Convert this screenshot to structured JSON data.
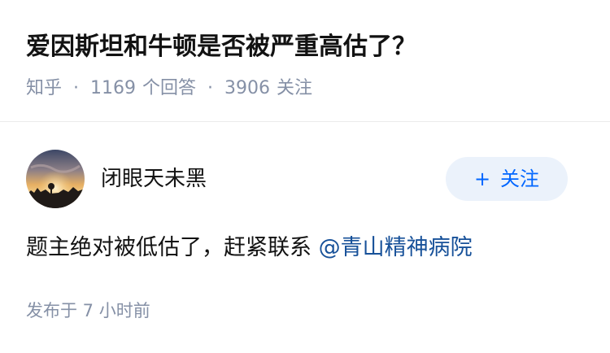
{
  "question": {
    "title": "爱因斯坦和牛顿是否被严重高估了？",
    "source": "知乎",
    "separator": "·",
    "answer_count": "1169",
    "answer_label": "个回答",
    "follower_count": "3906",
    "follower_label": "关注"
  },
  "author": {
    "name": "闭眼天未黑",
    "avatar_icon": "sunset-photo-avatar",
    "follow_icon": "plus-icon",
    "follow_plus": "+",
    "follow_label": "关注"
  },
  "answer": {
    "text": "题主绝对被低估了，赶紧联系 ",
    "mention": "@青山精神病院",
    "published": "发布于  7 小时前"
  },
  "colors": {
    "meta": "#8590a6",
    "link": "#175199",
    "follow_text": "#0066ff",
    "follow_bg": "#ebf2fb"
  }
}
